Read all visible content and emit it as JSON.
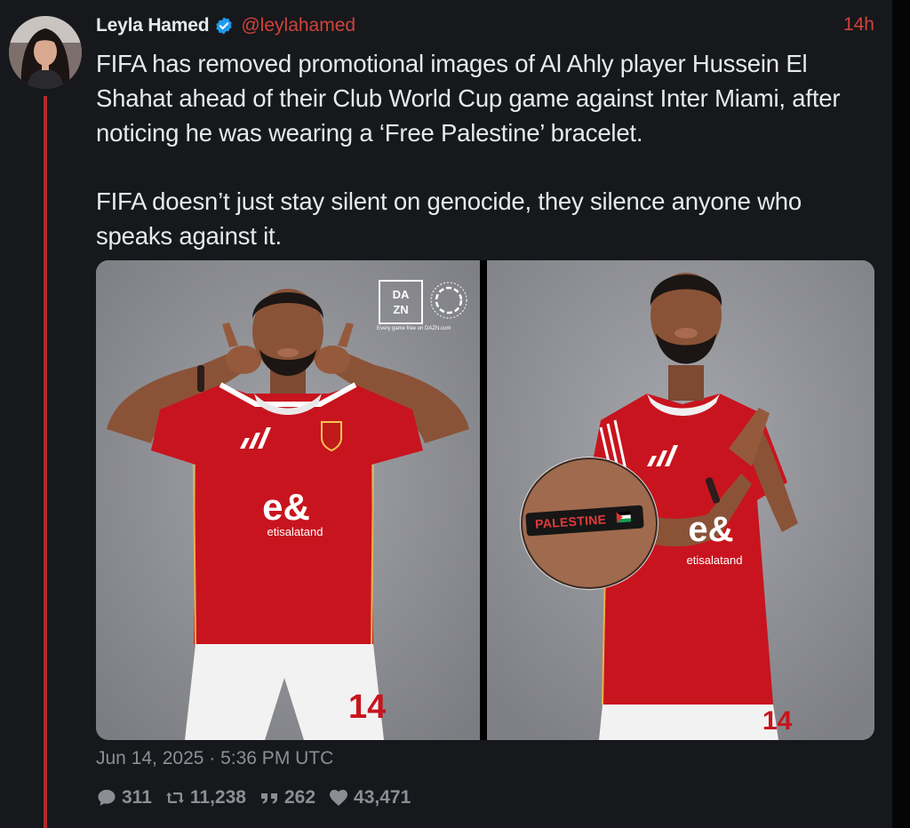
{
  "tweet": {
    "display_name": "Leyla Hamed",
    "handle": "@leylahamed",
    "time_ago": "14h",
    "paragraphs": [
      "FIFA has removed promotional images of Al Ahly player Hussein El Shahat ahead of their Club World Cup game against Inter Miami, after noticing he was wearing a ‘Free Palestine’ bracelet.",
      "FIFA doesn’t just stay silent on genocide, they silence anyone who speaks against it."
    ],
    "timestamp": "Jun 14, 2025 · 5:36 PM UTC"
  },
  "media": {
    "left": {
      "dazn_top": "DA",
      "dazn_bottom": "ZN",
      "dazn_note": "Every game free on DAZN.com",
      "sponsor": "etisalatand",
      "sponsor_mark": "e&",
      "shirt_number": "14"
    },
    "right": {
      "bracelet_text": "PALESTINE",
      "sponsor": "etisalatand",
      "sponsor_mark": "e&",
      "shirt_number": "14"
    }
  },
  "stats": {
    "replies": "311",
    "retweets": "11,238",
    "quotes": "262",
    "likes": "43,471"
  },
  "icons": {
    "verified": "verified-badge-icon",
    "reply": "reply-icon",
    "retweet": "retweet-icon",
    "quote": "quote-icon",
    "like": "heart-icon"
  },
  "colors": {
    "background": "#16181c",
    "accent": "#d0433a",
    "thread_line": "#b32a28",
    "verified": "#1d9bf0",
    "muted": "#8b8f95",
    "jersey": "#c8141e"
  }
}
